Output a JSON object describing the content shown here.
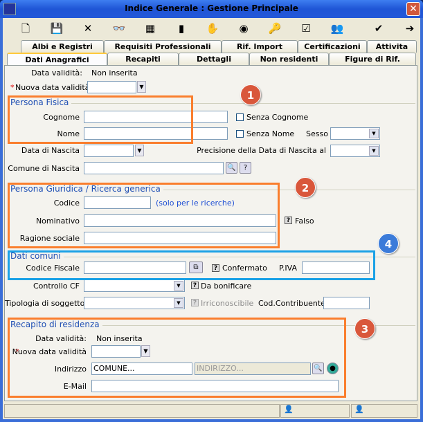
{
  "window": {
    "title": "Indice Generale : Gestione Principale",
    "close": "✕"
  },
  "toolbar": [
    {
      "icon": "new-document-icon",
      "g": "🗋"
    },
    {
      "icon": "save-icon",
      "g": "💾"
    },
    {
      "icon": "delete-icon",
      "g": "✕"
    },
    {
      "icon": "search-binoculars-icon",
      "g": "👓"
    },
    {
      "icon": "tree-icon",
      "g": "▦"
    },
    {
      "icon": "binder-icon",
      "g": "▮"
    },
    {
      "icon": "stamp-icon",
      "g": "✋"
    },
    {
      "icon": "camera-icon",
      "g": "◉"
    },
    {
      "icon": "key-icon",
      "g": "🔑"
    },
    {
      "icon": "checked-document-icon",
      "g": "☑"
    },
    {
      "icon": "users-icon",
      "g": "👥"
    },
    {
      "icon": "confirm-icon",
      "g": "✔"
    },
    {
      "icon": "exit-icon",
      "g": "➔"
    }
  ],
  "tabs_row1": [
    "Albi e Registri",
    "Requisiti Professionali",
    "Rif. Import",
    "Certificazioni",
    "Attivita"
  ],
  "tabs_row2": [
    "Dati Anagrafici",
    "Recapiti",
    "Dettagli",
    "Non residenti",
    "Figure di Rif."
  ],
  "top": {
    "data_validita_label": "Data validità:",
    "data_validita_value": "Non inserita",
    "nuova_label": "Nuova data validità",
    "required": "*"
  },
  "persona_fisica": {
    "title": "Persona Fisica",
    "cognome": "Cognome",
    "nome": "Nome",
    "senza_cognome": "Senza Cognome",
    "senza_nome": "Senza Nome",
    "sesso": "Sesso",
    "data_nascita": "Data di Nascita",
    "precisione": "Precisione della Data di Nascita al",
    "comune_nascita": "Comune di Nascita"
  },
  "persona_giuridica": {
    "title": "Persona Giuridica / Ricerca generica",
    "codice": "Codice",
    "codice_hint": "(solo per le ricerche)",
    "nominativo": "Nominativo",
    "falso": "Falso",
    "ragione_sociale": "Ragione sociale"
  },
  "dati_comuni": {
    "title": "Dati comuni",
    "codice_fiscale": "Codice Fiscale",
    "confermato": "Confermato",
    "piva": "P.IVA",
    "controllo_cf": "Controllo CF",
    "da_bonificare": "Da bonificare",
    "tipologia": "Tipologia di soggetto",
    "irriconoscibile": "Irriconoscibile",
    "cod_contribuente": "Cod.Contribuente"
  },
  "recapito": {
    "title": "Recapito di residenza",
    "data_validita_label": "Data validità:",
    "data_validita_value": "Non inserita",
    "nuova_label": "Nuova data validità",
    "required": "*",
    "indirizzo": "Indirizzo",
    "comune_value": "COMUNE...",
    "indirizzo_value": "INDIRIZZO...",
    "email": "E-Mail"
  },
  "badges": [
    "1",
    "2",
    "3",
    "4"
  ],
  "colors": {
    "annotation_orange": "#fa7e2d",
    "annotation_blue": "#1aa1e6",
    "badge_red": "#d9573b",
    "badge_blue": "#3b7bd9",
    "group_title": "#1f4fb4"
  }
}
